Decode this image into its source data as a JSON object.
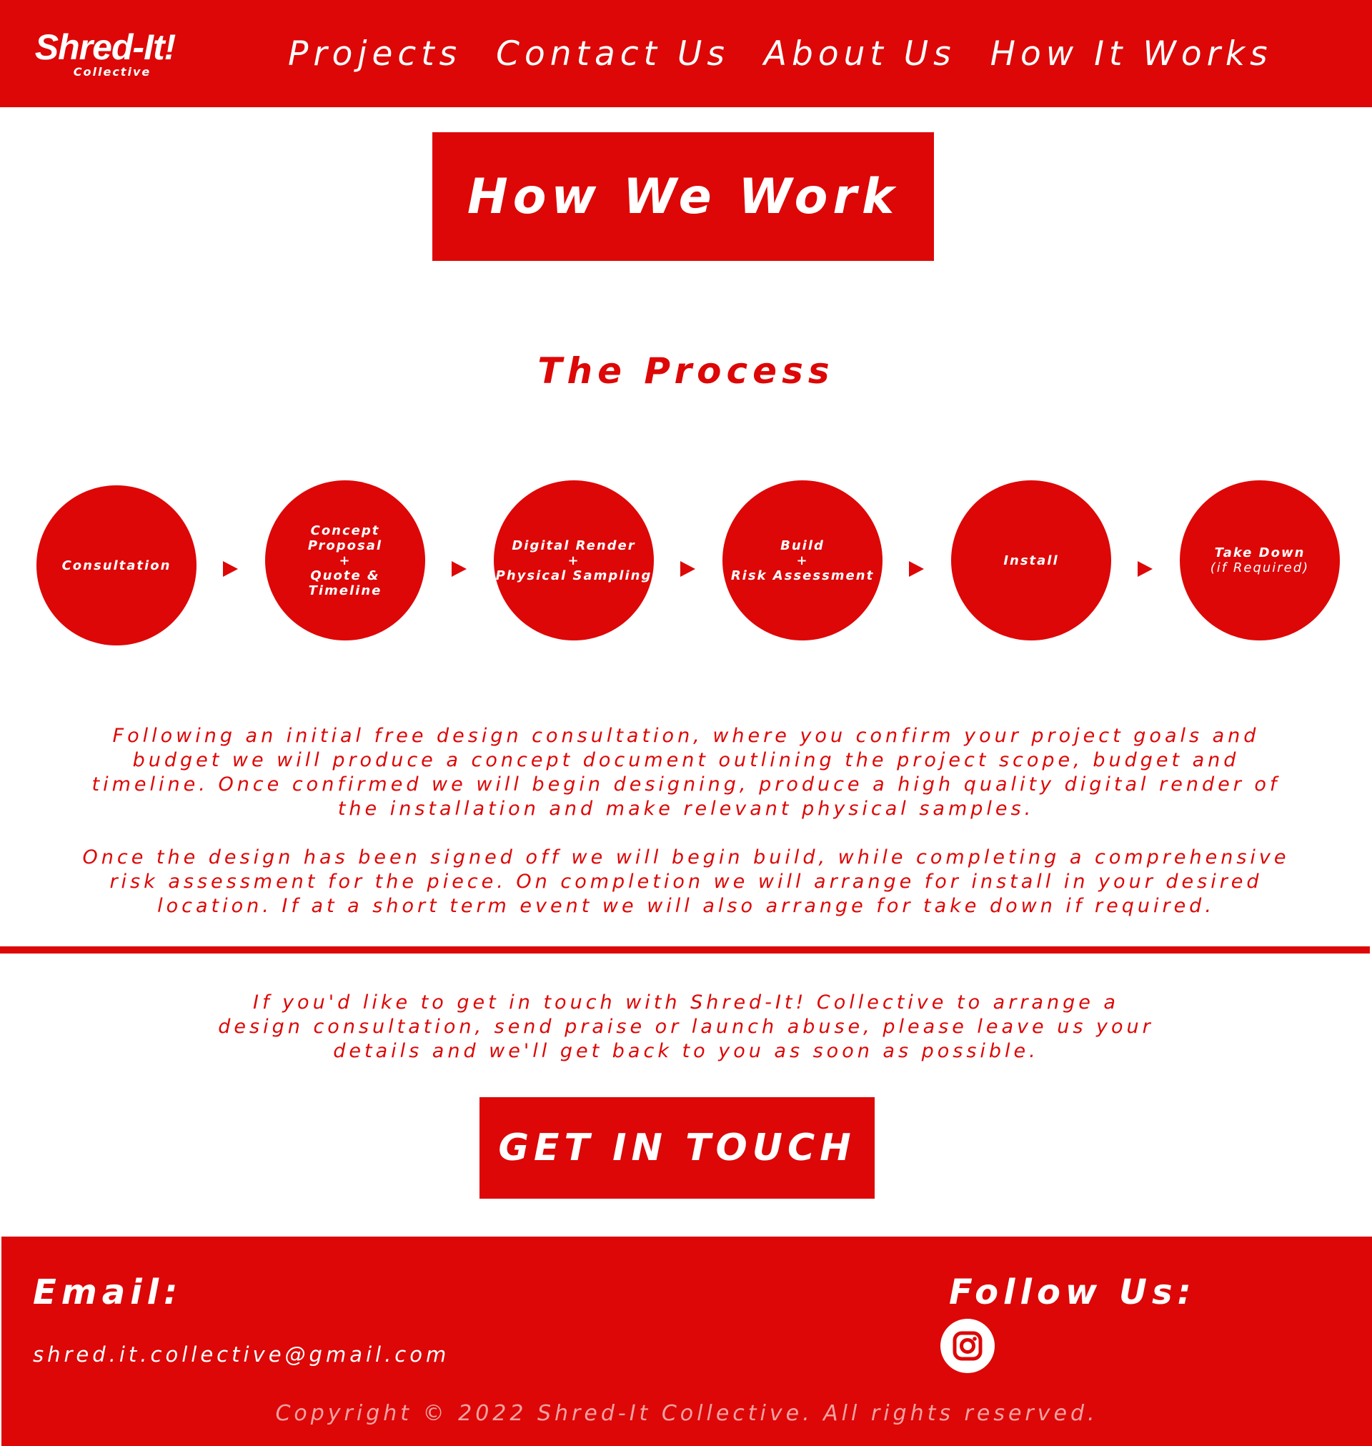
{
  "header": {
    "logo_main": "Shred-It!",
    "logo_sub": "Collective",
    "nav": [
      "Projects",
      "Contact Us",
      "About Us",
      "How It Works"
    ]
  },
  "hero": {
    "title": "How We Work"
  },
  "process": {
    "title": "The Process",
    "steps": [
      {
        "lines": [
          "Consultation"
        ]
      },
      {
        "lines": [
          "Concept",
          "Proposal",
          "+",
          "Quote &",
          "Timeline"
        ]
      },
      {
        "lines": [
          "Digital Render",
          "+",
          "Physical Sampling"
        ]
      },
      {
        "lines": [
          "Build",
          "+",
          "Risk Assessment"
        ]
      },
      {
        "lines": [
          "Install"
        ]
      },
      {
        "lines": [
          "Take Down",
          "(if Required)"
        ]
      }
    ]
  },
  "description": {
    "paragraph1": "Following an initial free design consultation, where you confirm your project goals and budget we will produce a concept document outlining the project scope, budget and timeline. Once confirmed we will begin designing, produce a high quality digital render of the installation and make relevant physical samples.",
    "paragraph2": "Once the design has been signed off we will begin build, while completing a comprehensive risk assessment for the piece. On completion we will arrange for install in your desired location. If at a short term event we will also arrange for take down if required."
  },
  "contact": {
    "text": "If you'd like to get in touch with Shred-It! Collective to arrange a design consultation, send praise or launch abuse, please leave us your details and we'll get back to you as soon as possible.",
    "button": "GET IN TOUCH"
  },
  "footer": {
    "email_label": "Email:",
    "email": "shred.it.collective@gmail.com",
    "follow_label": "Follow Us:",
    "social_icon": "instagram-icon",
    "copyright": "Copyright © 2022 Shred-It Collective. All rights reserved."
  },
  "colors": {
    "brand_red": "#dd0707",
    "white": "#ffffff",
    "copyright_text": "#f3a3a3"
  }
}
